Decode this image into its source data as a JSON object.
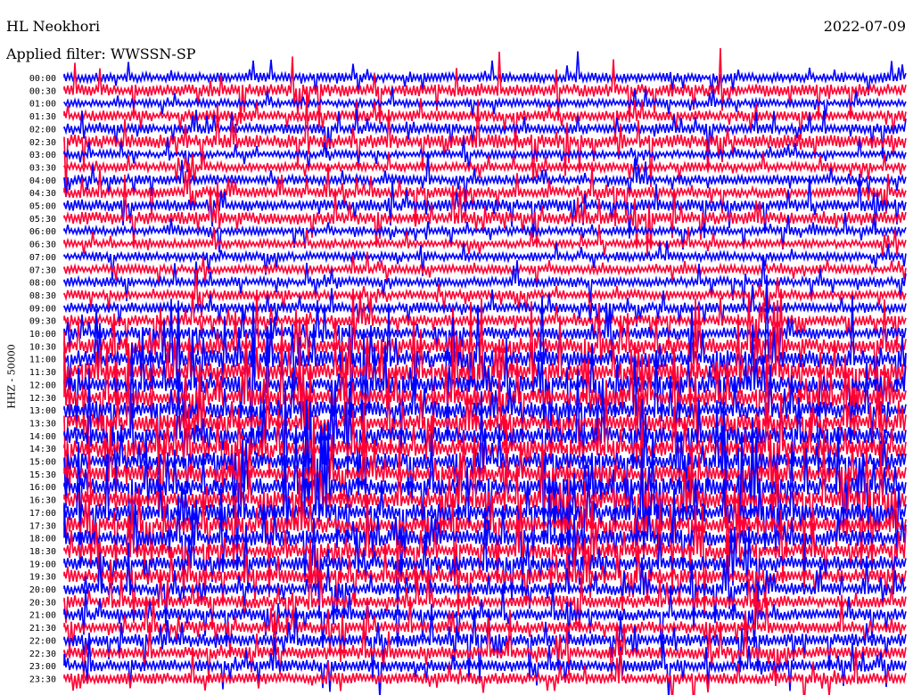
{
  "header": {
    "station": "HL Neokhori",
    "date": "2022-07-09",
    "filter": "Applied filter: WWSSN-SP"
  },
  "chart_data": {
    "type": "line",
    "title": "HL Neokhori",
    "ylabel": "HHZ - 50000",
    "rows": [
      "00:00",
      "00:30",
      "01:00",
      "01:30",
      "02:00",
      "02:30",
      "03:00",
      "03:30",
      "04:00",
      "04:30",
      "05:00",
      "05:30",
      "06:00",
      "06:30",
      "07:00",
      "07:30",
      "08:00",
      "08:30",
      "09:00",
      "09:30",
      "10:00",
      "10:30",
      "11:00",
      "11:30",
      "12:00",
      "12:30",
      "13:00",
      "13:30",
      "14:00",
      "14:30",
      "15:00",
      "15:30",
      "16:00",
      "16:30",
      "17:00",
      "17:30",
      "18:00",
      "18:30",
      "19:00",
      "19:30",
      "20:00",
      "20:30",
      "21:00",
      "21:30",
      "22:00",
      "22:30",
      "23:00",
      "23:30"
    ],
    "colors": [
      "#0000ff",
      "#ff0033"
    ],
    "amplitude_level": [
      0.35,
      0.6,
      0.2,
      0.45,
      0.4,
      0.7,
      0.2,
      0.3,
      0.35,
      0.45,
      0.55,
      0.6,
      0.25,
      0.25,
      0.3,
      0.3,
      0.35,
      0.35,
      0.4,
      0.45,
      0.6,
      0.9,
      1.0,
      1.0,
      1.0,
      1.0,
      1.0,
      1.0,
      1.0,
      1.0,
      1.0,
      1.0,
      1.0,
      1.0,
      1.0,
      0.95,
      0.9,
      0.85,
      0.8,
      0.75,
      0.6,
      0.6,
      0.55,
      0.55,
      0.6,
      0.6,
      0.55,
      0.5
    ]
  }
}
